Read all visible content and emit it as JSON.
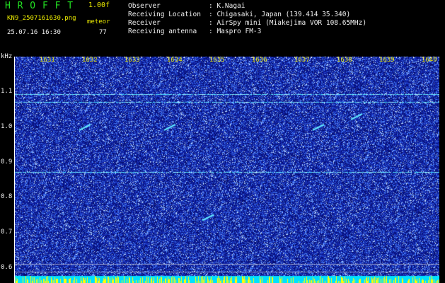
{
  "header": {
    "app_title": "H R O F F T",
    "version": "1.00f",
    "filename": "KN9_2507161630.png",
    "mode_label": "meteor",
    "datetime": "25.07.16 16:30",
    "count": "77",
    "observer_label": "Observer",
    "observer_value": ": K.Nagai",
    "location_label": "Receiving Location",
    "location_value": ": Chigasaki, Japan (139.414 35.340)",
    "receiver_label": "Receiver",
    "receiver_value": ": AirSpy mini (Miakejima VOR 108.65MHz)",
    "antenna_label": "Receiving antenna",
    "antenna_value": ": Maspro FM-3"
  },
  "axis": {
    "unit": "kHz",
    "y_ticks": [
      "1.1",
      "1.0",
      "0.9",
      "0.8",
      "0.7",
      "0.6"
    ],
    "x_ticks": [
      "1631",
      "1632",
      "1633",
      "1634",
      "1635",
      "1636",
      "1637",
      "1638",
      "1639",
      "1640"
    ]
  },
  "colors": {
    "background": "#000000",
    "spectrogram": "#0a1aa0",
    "noise": "#4a8cff",
    "signal": "#40e0ff",
    "bottom_band": "#00e0ff",
    "bottom_spikes": "#ffff00",
    "header_green": "#22e022",
    "header_yellow": "#e8e800"
  },
  "features": {
    "horizontal_signal_lines_khz": [
      1.095,
      1.072,
      0.875
    ],
    "faint_lines_khz": [
      0.615,
      0.593
    ],
    "meteor_trails": [
      {
        "x_time": "1632",
        "khz": 1.0
      },
      {
        "x_time": "1634",
        "khz": 1.0
      },
      {
        "x_time": "1637.5",
        "khz": 1.0
      },
      {
        "x_time": "1638.4",
        "khz": 1.03
      },
      {
        "x_time": "1634.9",
        "khz": 0.745
      }
    ]
  }
}
